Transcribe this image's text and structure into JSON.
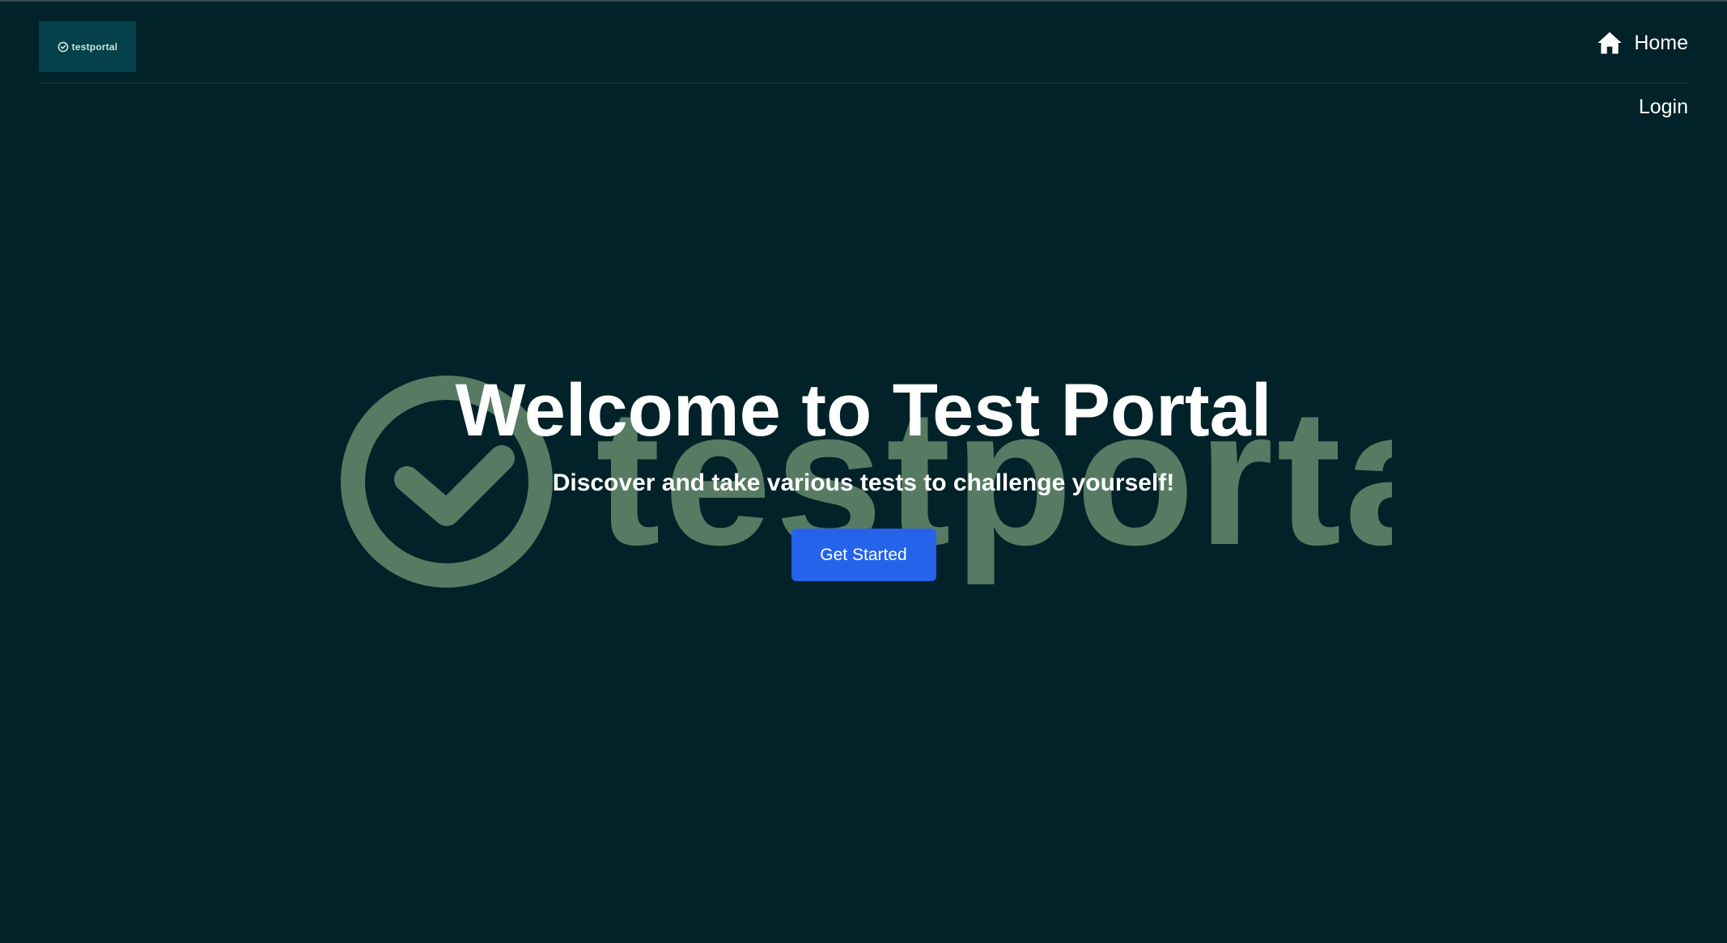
{
  "header": {
    "logo_text": "testportal",
    "nav": {
      "home_label": "Home",
      "home_icon": "home-icon",
      "login_label": "Login"
    }
  },
  "watermark": {
    "text": "testportal",
    "icon": "check-circle-icon",
    "color": "#567b62"
  },
  "hero": {
    "title": "Welcome to Test Portal",
    "subtitle": "Discover and take various tests to challenge yourself!",
    "cta_label": "Get Started"
  },
  "colors": {
    "background": "#012228",
    "logo_background": "#04414a",
    "accent": "#2563eb",
    "text": "#ffffff"
  }
}
